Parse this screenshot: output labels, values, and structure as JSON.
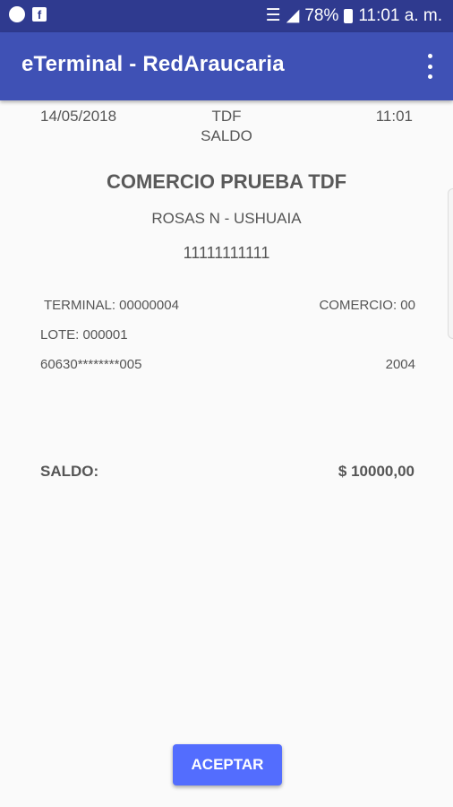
{
  "status_bar": {
    "battery": "78%",
    "time": "11:01 a. m."
  },
  "app_bar": {
    "title": "eTerminal - RedAraucaria"
  },
  "receipt": {
    "date": "14/05/2018",
    "terminal_code": "TDF",
    "time": "11:01",
    "transaction_type": "SALDO",
    "merchant_name": "COMERCIO PRUEBA TDF",
    "address": "ROSAS N      - USHUAIA",
    "phone": "11111111111",
    "terminal": "TERMINAL: 00000004",
    "comercio": "COMERCIO:     00",
    "lote": "LOTE: 000001",
    "card_number": "60630********005",
    "card_expiry": "2004",
    "balance_label": "SALDO:",
    "balance_amount": "$   10000,00"
  },
  "actions": {
    "accept_label": "ACEPTAR"
  }
}
